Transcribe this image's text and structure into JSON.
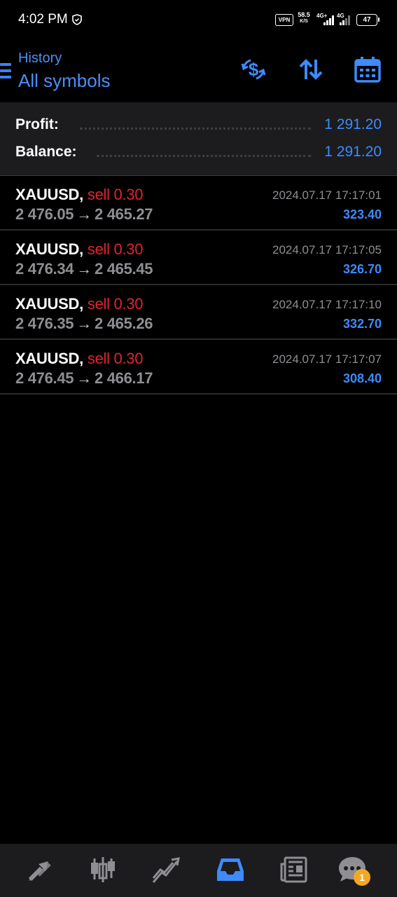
{
  "status_bar": {
    "time": "4:02 PM",
    "vpn": "VPN",
    "net_speed_value": "58.5",
    "net_speed_unit": "K/S",
    "signal1_label": "4G+",
    "signal2_label": "4G",
    "battery": "47"
  },
  "header": {
    "subtitle": "History",
    "title": "All symbols"
  },
  "summary": {
    "profit_label": "Profit:",
    "profit_value": "1 291.20",
    "balance_label": "Balance:",
    "balance_value": "1 291.20"
  },
  "deals": [
    {
      "symbol": "XAUUSD,",
      "type": "sell 0.30",
      "open_price": "2 476.05",
      "arrow": "→",
      "close_price": "2 465.27",
      "time": "2024.07.17 17:17:01",
      "profit": "323.40"
    },
    {
      "symbol": "XAUUSD,",
      "type": "sell 0.30",
      "open_price": "2 476.34",
      "arrow": "→",
      "close_price": "2 465.45",
      "time": "2024.07.17 17:17:05",
      "profit": "326.70"
    },
    {
      "symbol": "XAUUSD,",
      "type": "sell 0.30",
      "open_price": "2 476.35",
      "arrow": "→",
      "close_price": "2 465.26",
      "time": "2024.07.17 17:17:10",
      "profit": "332.70"
    },
    {
      "symbol": "XAUUSD,",
      "type": "sell 0.30",
      "open_price": "2 476.45",
      "arrow": "→",
      "close_price": "2 466.17",
      "time": "2024.07.17 17:17:07",
      "profit": "308.40"
    }
  ],
  "bottom_nav": {
    "chat_badge": "1"
  },
  "colors": {
    "accent": "#3d8bfd",
    "sell": "#e0242b",
    "muted": "#8e8e93",
    "badge": "#f5a623"
  }
}
